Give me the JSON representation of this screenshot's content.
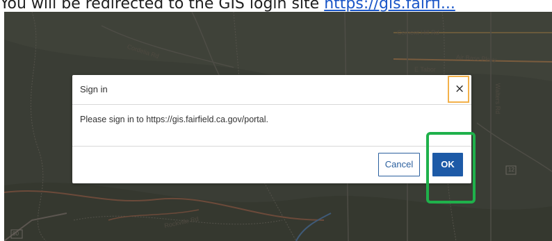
{
  "instruction": {
    "text": "You will be redirected to the GIS login site ",
    "link_text": "https://gis.fairfi..."
  },
  "map": {
    "labels": {
      "cement_hill": "Cement Hill Rd",
      "air_base": "Air Base Pkwy",
      "tabor": "E Tabor",
      "walters": "Walters Rd",
      "cordelia": "Cordelia Rd",
      "rockville": "Rockville Rd",
      "shield_12": "12",
      "shield_80": "80"
    }
  },
  "dialog": {
    "title": "Sign in",
    "close_glyph": "×",
    "message": "Please sign in to https://gis.fairfield.ca.gov/portal.",
    "cancel_label": "Cancel",
    "ok_label": "OK"
  },
  "colors": {
    "ok_button": "#1d5aa7",
    "cancel_border": "#2a5f9e",
    "close_focus": "#f3b14a",
    "highlight": "#1fb14b",
    "map_overlay": "#3a3d35"
  }
}
